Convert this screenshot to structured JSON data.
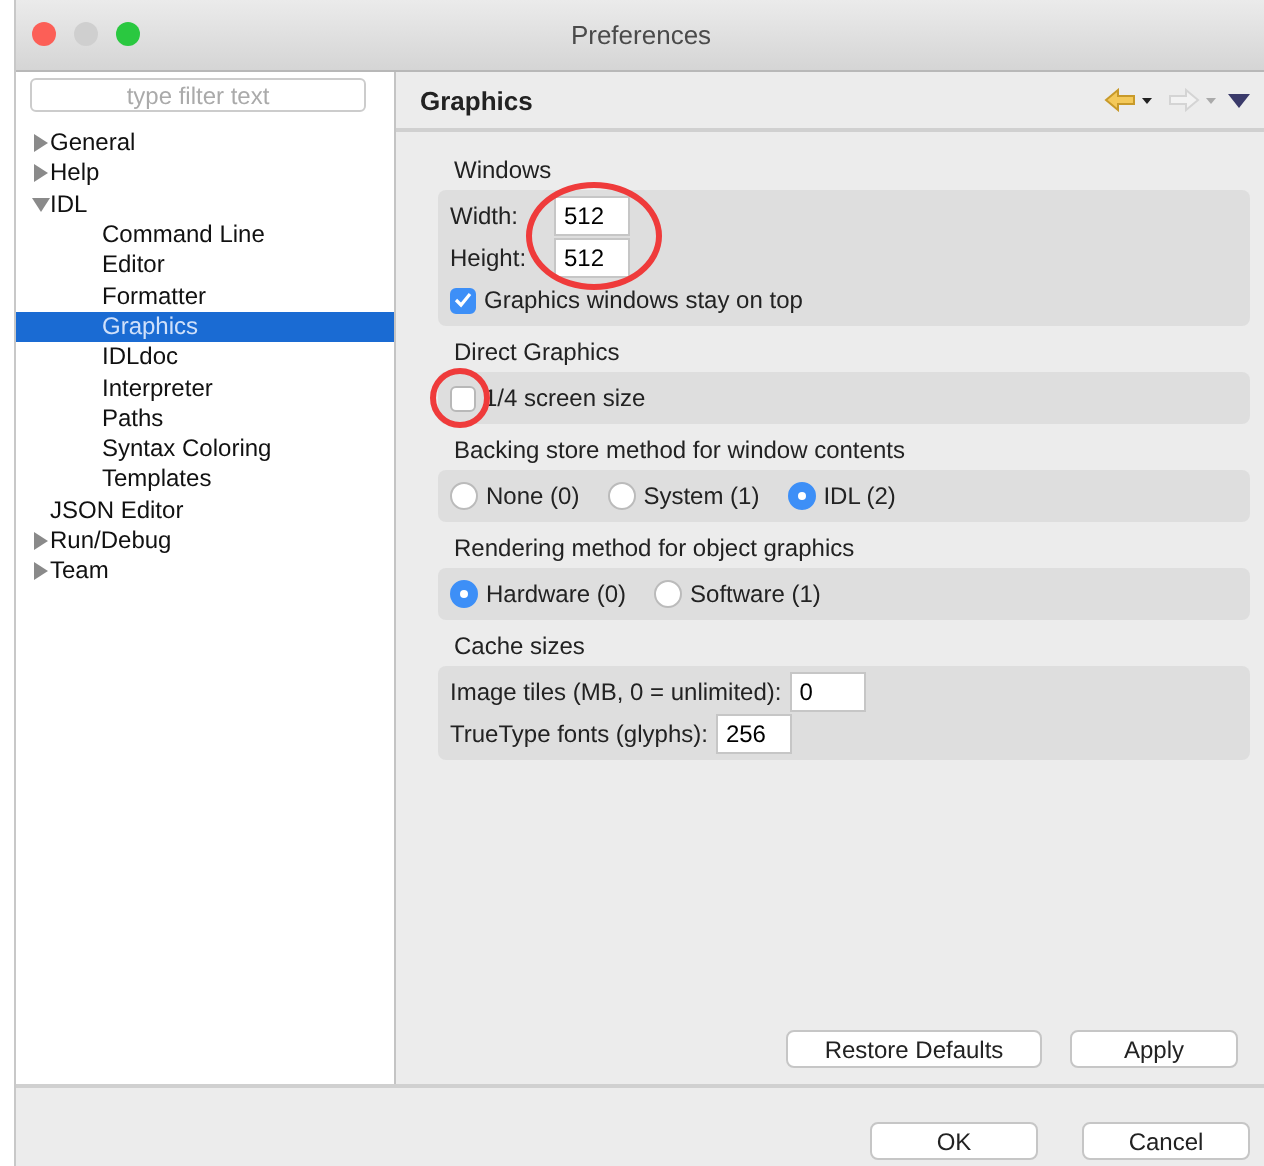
{
  "window": {
    "title": "Preferences"
  },
  "filter": {
    "placeholder": "type filter text"
  },
  "tree": [
    {
      "label": "General",
      "kind": "branch",
      "expanded": false,
      "selected": false
    },
    {
      "label": "Help",
      "kind": "branch",
      "expanded": false,
      "selected": false
    },
    {
      "label": "IDL",
      "kind": "branch",
      "expanded": true,
      "selected": false,
      "children": [
        {
          "label": "Command Line",
          "kind": "leaf",
          "selected": false
        },
        {
          "label": "Editor",
          "kind": "leaf",
          "selected": false
        },
        {
          "label": "Formatter",
          "kind": "leaf",
          "selected": false
        },
        {
          "label": "Graphics",
          "kind": "leaf",
          "selected": true
        },
        {
          "label": "IDLdoc",
          "kind": "leaf",
          "selected": false
        },
        {
          "label": "Interpreter",
          "kind": "leaf",
          "selected": false
        },
        {
          "label": "Paths",
          "kind": "leaf",
          "selected": false
        },
        {
          "label": "Syntax Coloring",
          "kind": "leaf",
          "selected": false
        },
        {
          "label": "Templates",
          "kind": "leaf",
          "selected": false
        }
      ]
    },
    {
      "label": "JSON Editor",
      "kind": "leaf",
      "selected": false
    },
    {
      "label": "Run/Debug",
      "kind": "branch",
      "expanded": false,
      "selected": false
    },
    {
      "label": "Team",
      "kind": "branch",
      "expanded": false,
      "selected": false
    }
  ],
  "page": {
    "title": "Graphics"
  },
  "groups": [
    {
      "title": "Windows",
      "rows": [
        {
          "kind": "field",
          "label": "Width:",
          "value": "512"
        },
        {
          "kind": "field",
          "label": "Height:",
          "value": "512"
        },
        {
          "kind": "checkbox",
          "label": "Graphics windows stay on top",
          "checked": true
        }
      ]
    },
    {
      "title": "Direct Graphics",
      "rows": [
        {
          "kind": "checkbox",
          "label": "1/4 screen size",
          "checked": false
        }
      ]
    },
    {
      "title": "Backing store method for window contents",
      "rows": [
        {
          "kind": "radios",
          "options": [
            {
              "label": "None (0)",
              "selected": false
            },
            {
              "label": "System (1)",
              "selected": false
            },
            {
              "label": "IDL (2)",
              "selected": true
            }
          ]
        }
      ]
    },
    {
      "title": "Rendering method for object graphics",
      "rows": [
        {
          "kind": "radios",
          "options": [
            {
              "label": "Hardware (0)",
              "selected": true
            },
            {
              "label": "Software (1)",
              "selected": false
            }
          ]
        }
      ]
    },
    {
      "title": "Cache sizes",
      "rows": [
        {
          "kind": "field",
          "label": "Image tiles (MB, 0 = unlimited):",
          "value": "0"
        },
        {
          "kind": "field",
          "label": "TrueType fonts (glyphs):",
          "value": "256"
        }
      ]
    }
  ],
  "page_buttons": [
    "Restore Defaults",
    "Apply"
  ],
  "dialog_buttons": [
    "OK",
    "Cancel"
  ]
}
